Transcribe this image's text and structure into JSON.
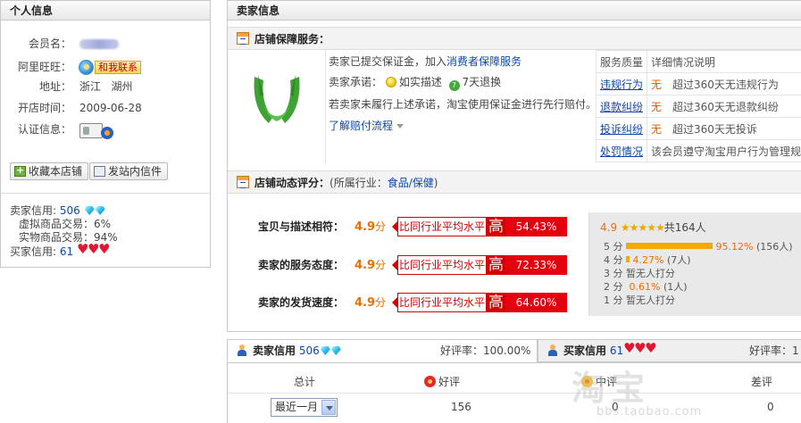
{
  "personal": {
    "title": "个人信息",
    "member_label": "会员名：",
    "aliww_label": "阿里旺旺：",
    "contact_label": "和我联系",
    "address_label": "地址：",
    "address_province": "浙江",
    "address_city": "湖州",
    "opened_label": "开店时间：",
    "opened_value": "2009-06-28",
    "cert_label": "认证信息：",
    "fav_shop_button": "收藏本店铺",
    "message_button": "发站内信件",
    "seller_credit_label": "卖家信用:",
    "seller_credit_value": "506",
    "virtual_label": "虚拟商品交易：",
    "virtual_value": "6%",
    "physical_label": "实物商品交易：",
    "physical_value": "94%",
    "buyer_credit_label": "买家信用:",
    "buyer_credit_value": "61"
  },
  "seller": {
    "title": "卖家信息",
    "guarantee": {
      "title": "店铺保障服务：",
      "deposit_text": "卖家已提交保证金，加入",
      "deposit_link": "消费者保障服务",
      "promise_label": "卖家承诺：",
      "promise_1": "如实描述",
      "promise_2": "7天退换",
      "compensation_text": "若卖家未履行上述承诺，淘宝使用保证金进行先行赔付。",
      "compensation_link": "了解赔付流程",
      "table_header": [
        "服务质量",
        "详细情况说明"
      ],
      "table_rows": [
        {
          "item": "违规行为",
          "status": "无",
          "detail": "超过360天无违规行为"
        },
        {
          "item": "退款纠纷",
          "status": "无",
          "detail": "超过360天无退款纠纷"
        },
        {
          "item": "投诉纠纷",
          "status": "无",
          "detail": "超过360天无投诉"
        },
        {
          "item": "处罚情况",
          "status": "",
          "detail": "该会员遵守淘宝用户行为管理规则"
        }
      ]
    },
    "dynamic": {
      "title": "店铺动态评分：",
      "industry_prefix": "(所属行业：",
      "industry_link": "食品/保健",
      "industry_suffix": ")",
      "scores": [
        {
          "label": "宝贝与描述相符：",
          "score": "4.9",
          "unit": "分",
          "compare": "比同行业平均水平",
          "level": "高",
          "percent": "54.43%"
        },
        {
          "label": "卖家的服务态度：",
          "score": "4.9",
          "unit": "分",
          "compare": "比同行业平均水平",
          "level": "高",
          "percent": "72.33%"
        },
        {
          "label": "卖家的发货速度：",
          "score": "4.9",
          "unit": "分",
          "compare": "比同行业平均水平",
          "level": "高",
          "percent": "64.60%"
        }
      ],
      "distribution": {
        "avg": "4.9",
        "stars": "★★★★★",
        "total": "共164人",
        "rows": [
          {
            "label": "5 分",
            "value": "95.12%",
            "count": "(156人)",
            "share": 0.9512
          },
          {
            "label": "4 分",
            "value": "4.27%",
            "count": "(7人)",
            "share": 0.0427
          },
          {
            "label": "3 分",
            "value": "",
            "count": "暂无人打分",
            "share": 0
          },
          {
            "label": "2 分",
            "value": "0.61%",
            "count": "(1人)",
            "share": 0
          },
          {
            "label": "1 分",
            "value": "",
            "count": "暂无人打分",
            "share": 0
          }
        ]
      }
    }
  },
  "credit_tabs": {
    "seller_tab": "卖家信用",
    "seller_value": "506",
    "seller_rate": "好评率：100.00%",
    "buyer_tab": "买家信用",
    "buyer_value": "61",
    "buyer_rate": "好评率：1",
    "table_headers": {
      "total": "总计",
      "good": "好评",
      "neutral": "中评",
      "bad": "差评"
    },
    "period_select": "最近一月",
    "row_values": {
      "good": "156",
      "neutral": "0",
      "bad": "0"
    }
  },
  "watermark": {
    "main": "淘宝",
    "sub": "bbs.taobao.com"
  },
  "colors": {
    "accent": "#1046a8",
    "highlight": "#e4000f",
    "orange": "#ee6d00",
    "star": "#f0a800"
  }
}
